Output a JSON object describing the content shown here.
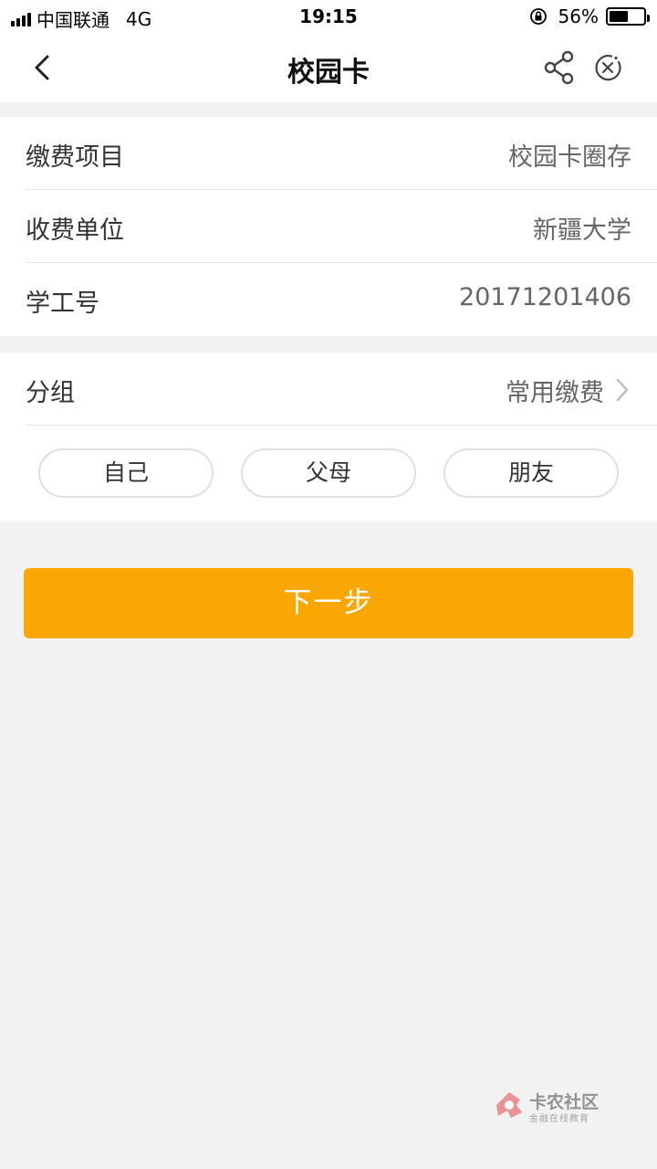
{
  "status_bar": {
    "carrier": "中国联通",
    "network": "4G",
    "time": "19:15",
    "battery_pct": "56%",
    "battery_level": 0.56
  },
  "nav": {
    "title": "校园卡",
    "back_icon": "chevron-left-icon",
    "share_icon": "share-icon",
    "close_icon": "close-circle-icon"
  },
  "info": {
    "rows": [
      {
        "label": "缴费项目",
        "value": "校园卡圈存"
      },
      {
        "label": "收费单位",
        "value": "新疆大学"
      },
      {
        "label": "学工号",
        "value": "20171201406"
      }
    ]
  },
  "group": {
    "label": "分组",
    "value": "常用缴费",
    "chips": [
      "自己",
      "父母",
      "朋友"
    ]
  },
  "next_button_label": "下一步",
  "watermark": {
    "title": "卡农社区",
    "subtitle": "金融在线教育"
  },
  "colors": {
    "accent": "#fba703",
    "background": "#f2f2f2"
  }
}
